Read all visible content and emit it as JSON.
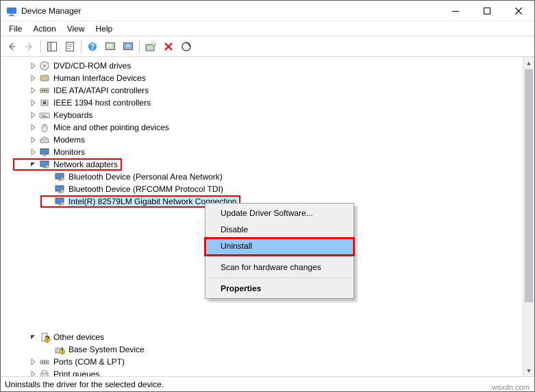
{
  "window": {
    "title": "Device Manager"
  },
  "menubar": [
    "File",
    "Action",
    "View",
    "Help"
  ],
  "toolbar_icons": [
    "back",
    "forward",
    "sep",
    "show-tree",
    "properties",
    "sep",
    "help",
    "monitor-grid",
    "monitor-play",
    "sep",
    "add-hw",
    "remove",
    "scan"
  ],
  "tree": {
    "items": [
      {
        "label": "DVD/CD-ROM drives",
        "icon": "disc"
      },
      {
        "label": "Human Interface Devices",
        "icon": "hid"
      },
      {
        "label": "IDE ATA/ATAPI controllers",
        "icon": "ide"
      },
      {
        "label": "IEEE 1394 host controllers",
        "icon": "ieee"
      },
      {
        "label": "Keyboards",
        "icon": "keyboard"
      },
      {
        "label": "Mice and other pointing devices",
        "icon": "mouse"
      },
      {
        "label": "Modems",
        "icon": "modem"
      },
      {
        "label": "Monitors",
        "icon": "monitor"
      },
      {
        "label": "Network adapters",
        "icon": "net",
        "expanded": true,
        "highlight": true,
        "children": [
          {
            "label": "Bluetooth Device (Personal Area Network)",
            "icon": "net"
          },
          {
            "label": "Bluetooth Device (RFCOMM Protocol TDI)",
            "icon": "net"
          },
          {
            "label": "Intel(R) 82579LM Gigabit Network Connection",
            "icon": "net",
            "highlight": true,
            "selected": true
          }
        ]
      }
    ],
    "after_gap": [
      {
        "label": "Other devices",
        "icon": "other",
        "expanded": true,
        "children": [
          {
            "label": "Base System Device",
            "icon": "unknown-dev"
          }
        ]
      },
      {
        "label": "Ports (COM & LPT)",
        "icon": "port"
      },
      {
        "label": "Print queues",
        "icon": "printer"
      }
    ]
  },
  "context_menu": {
    "items": [
      {
        "label": "Update Driver Software...",
        "type": "item"
      },
      {
        "label": "Disable",
        "type": "item"
      },
      {
        "label": "Uninstall",
        "type": "item",
        "highlight": true
      },
      {
        "type": "sep"
      },
      {
        "label": "Scan for hardware changes",
        "type": "item"
      },
      {
        "type": "sep"
      },
      {
        "label": "Properties",
        "type": "item",
        "bold": true
      }
    ]
  },
  "statusbar": "Uninstalls the driver for the selected device.",
  "credit": "wsxdn.com"
}
